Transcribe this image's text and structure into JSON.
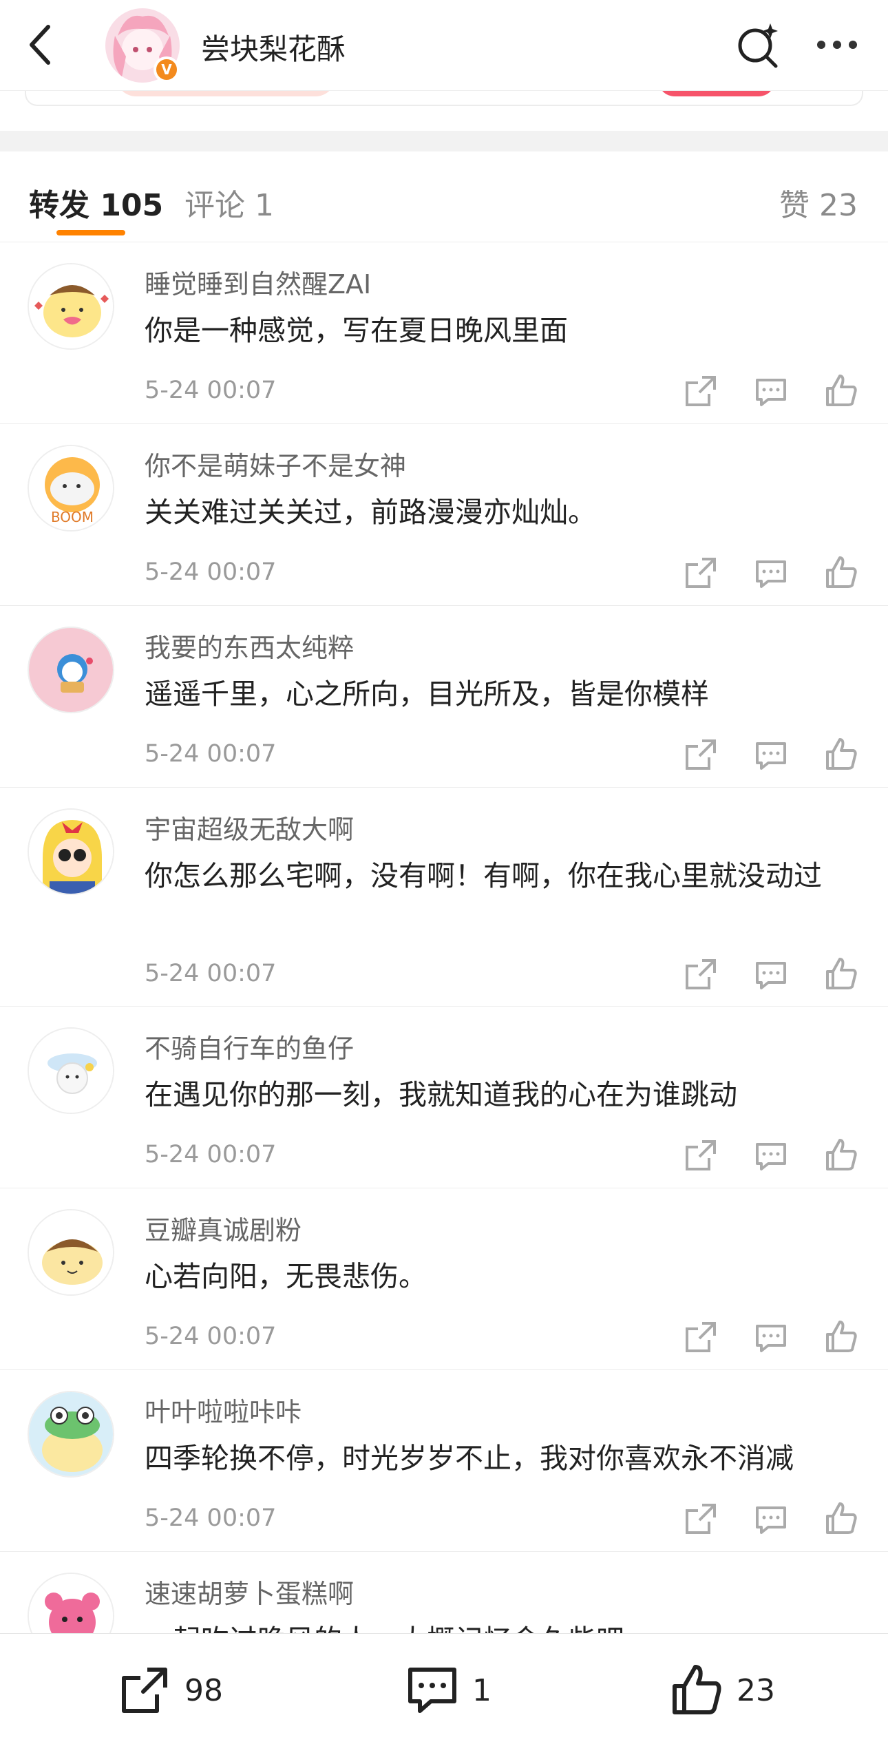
{
  "header": {
    "title": "尝块梨花酥",
    "verified_badge": "V"
  },
  "tabs": {
    "forward": "转发 105",
    "comments": "评论 1",
    "likes": "赞 23"
  },
  "reposts": [
    {
      "username": "睡觉睡到自然醒ZAI",
      "text": "你是一种感觉，写在夏日晚风里面",
      "time": "5-24 00:07",
      "avatar": "pompompurin-heart-avatar"
    },
    {
      "username": "你不是萌妹子不是女神",
      "text": "关关难过关关过，前路漫漫亦灿灿。",
      "time": "5-24 00:07",
      "avatar": "boom-seal-avatar"
    },
    {
      "username": "我要的东西太纯粹",
      "text": "遥遥千里，心之所向，目光所及，皆是你模样",
      "time": "5-24 00:07",
      "avatar": "doraemon-pink-avatar"
    },
    {
      "username": "宇宙超级无敌大啊",
      "text": "你怎么那么宅啊，没有啊！有啊，你在我心里就没动过",
      "time": "5-24 00:07",
      "avatar": "sailor-girl-avatar"
    },
    {
      "username": "不骑自行车的鱼仔",
      "text": "在遇见你的那一刻，我就知道我的心在为谁跳动",
      "time": "5-24 00:07",
      "avatar": "white-cat-avatar"
    },
    {
      "username": "豆瓣真诚剧粉",
      "text": "心若向阳，无畏悲伤。",
      "time": "5-24 00:07",
      "avatar": "pompompurin-avatar"
    },
    {
      "username": "叶叶啦啦咔咔",
      "text": "四季轮换不停，时光岁岁不止，我对你喜欢永不消减",
      "time": "5-24 00:07",
      "avatar": "frog-hat-pudding-avatar"
    },
    {
      "username": "速速胡萝卜蛋糕啊",
      "text": "一起吹过晚风的人，大概记忆会久些吧",
      "time": "",
      "avatar": "pink-bear-avatar"
    }
  ],
  "bottom_bar": {
    "repost_count": "98",
    "comment_count": "1",
    "like_count": "23"
  },
  "colors": {
    "accent": "#ff8200",
    "verified": "#f38a1d",
    "muted_text": "#9a9a9a"
  }
}
